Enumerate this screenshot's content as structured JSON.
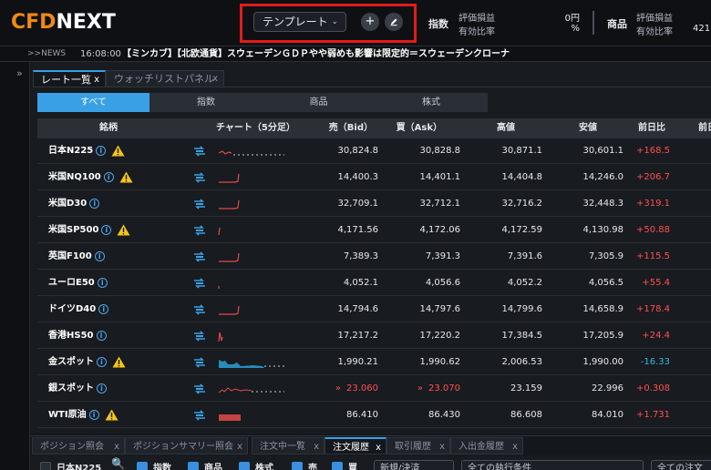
{
  "header": {
    "logo_cfd": "CFD",
    "logo_next": "NEXT",
    "template_label": "テンプレート",
    "index_label": "指数",
    "index_pnl_label": "評価損益",
    "index_pnl_value": "0円",
    "index_margin_label": "有効比率",
    "index_margin_value": "%",
    "commodity_label": "商品",
    "commodity_pnl_label": "評価損益",
    "commodity_margin_label": "有効比率",
    "commodity_margin_value": "421"
  },
  "news": {
    "tag": ">>NEWS",
    "time": "16:08:00",
    "headline": "【ミンカブ】【北欧通貨】スウェーデンＧＤＰやや弱めも影響は限定的＝スウェーデンクローナ"
  },
  "tabs": [
    {
      "label": "レート一覧",
      "close": "x"
    },
    {
      "label": "ウォッチリストパネル",
      "close": "x"
    }
  ],
  "filters": [
    "すべて",
    "指数",
    "商品",
    "株式"
  ],
  "columns": {
    "name": "銘柄",
    "chart": "チャート（5分足）",
    "bid": "売（Bid）",
    "ask": "買（Ask）",
    "high": "高値",
    "low": "安値",
    "change": "前日比",
    "extra": "前日"
  },
  "rows": [
    {
      "name": "日本N225",
      "warn": true,
      "bid": "30,824.8",
      "ask": "30,828.8",
      "high": "30,871.1",
      "low": "30,601.1",
      "change": "+168.5",
      "dir": "up",
      "hl": false,
      "spark": "flatline"
    },
    {
      "name": "米国NQ100",
      "warn": true,
      "bid": "14,400.3",
      "ask": "14,401.1",
      "high": "14,404.8",
      "low": "14,246.0",
      "change": "+206.7",
      "dir": "up",
      "hl": false,
      "spark": "hook"
    },
    {
      "name": "米国D30",
      "warn": false,
      "bid": "32,709.1",
      "ask": "32,712.1",
      "high": "32,716.2",
      "low": "32,448.3",
      "change": "+319.1",
      "dir": "up",
      "hl": false,
      "spark": "hook"
    },
    {
      "name": "米国SP500",
      "warn": true,
      "bid": "4,171.56",
      "ask": "4,172.06",
      "high": "4,172.59",
      "low": "4,130.98",
      "change": "+50.88",
      "dir": "up",
      "hl": false,
      "spark": "tick"
    },
    {
      "name": "英国F100",
      "warn": false,
      "bid": "7,389.3",
      "ask": "7,391.3",
      "high": "7,391.6",
      "low": "7,305.9",
      "change": "+115.5",
      "dir": "up",
      "hl": false,
      "spark": "hook"
    },
    {
      "name": "ユーロE50",
      "warn": false,
      "bid": "4,052.1",
      "ask": "4,056.6",
      "high": "4,052.2",
      "low": "4,056.5",
      "change": "+55.4",
      "dir": "up",
      "hl": false,
      "spark": "dot"
    },
    {
      "name": "ドイツD40",
      "warn": false,
      "bid": "14,794.6",
      "ask": "14,797.6",
      "high": "14,799.6",
      "low": "14,658.9",
      "change": "+178.4",
      "dir": "up",
      "hl": false,
      "spark": "hook"
    },
    {
      "name": "香港HS50",
      "warn": false,
      "bid": "17,217.2",
      "ask": "17,220.2",
      "high": "17,384.5",
      "low": "17,205.9",
      "change": "+24.4",
      "dir": "up",
      "hl": false,
      "spark": "spike"
    },
    {
      "name": "金スポット",
      "warn": true,
      "bid": "1,990.21",
      "ask": "1,990.62",
      "high": "2,006.53",
      "low": "1,990.00",
      "change": "-16.33",
      "dir": "down",
      "hl": false,
      "spark": "area"
    },
    {
      "name": "銀スポット",
      "warn": false,
      "bid": "23.060",
      "ask": "23.070",
      "high": "23.159",
      "low": "22.996",
      "change": "+0.308",
      "dir": "up",
      "hl": true,
      "spark": "noise"
    },
    {
      "name": "WTI原油",
      "warn": true,
      "bid": "86.410",
      "ask": "86.430",
      "high": "86.608",
      "low": "84.010",
      "change": "+1.731",
      "dir": "up",
      "hl": false,
      "spark": "block"
    }
  ],
  "bottom_tabs": [
    "ポジション照会",
    "ポジションサマリー照会",
    "注文中一覧",
    "注文履歴",
    "取引履歴",
    "入出金履歴"
  ],
  "bottom_filter": {
    "symbol_value": "日本N225",
    "checks": [
      "指数",
      "商品",
      "株式",
      "売",
      "買"
    ],
    "type_select": "新規/決済",
    "condition_select": "全ての執行条件",
    "order_select": "全ての注文"
  },
  "colors": {
    "accent": "#3aa0e6",
    "up": "#ff5050",
    "down": "#34b6e6",
    "warn": "#f5c518",
    "highlight": "#e31b1b"
  }
}
